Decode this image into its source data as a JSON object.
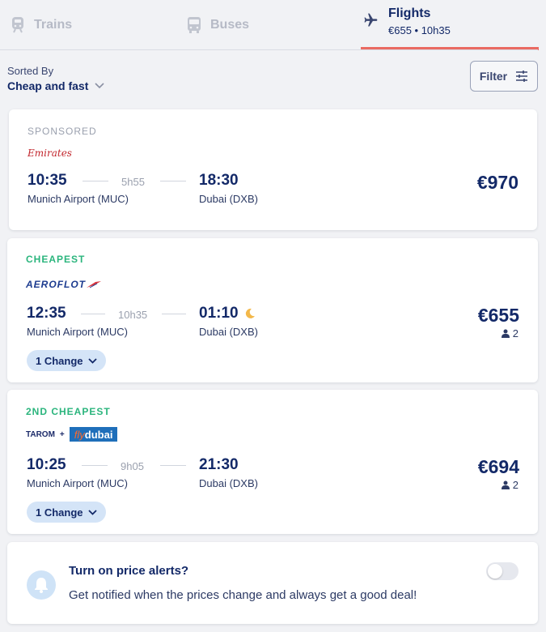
{
  "tabs": {
    "trains": {
      "label": "Trains",
      "icon": "train-icon"
    },
    "buses": {
      "label": "Buses",
      "icon": "bus-icon"
    },
    "flights": {
      "label": "Flights",
      "sub": "€655 • 10h35",
      "icon": "plane-icon",
      "active": true
    }
  },
  "sort": {
    "caption": "Sorted By",
    "value": "Cheap and fast"
  },
  "filter": {
    "label": "Filter"
  },
  "results": [
    {
      "tag": "SPONSORED",
      "airline": "Emirates",
      "depart_time": "10:35",
      "depart_place": "Munich Airport (MUC)",
      "duration": "5h55",
      "arrive_time": "18:30",
      "arrive_place": "Dubai (DXB)",
      "price": "€970"
    },
    {
      "tag": "CHEAPEST",
      "airline": "AEROFLOT",
      "depart_time": "12:35",
      "depart_place": "Munich Airport (MUC)",
      "duration": "10h35",
      "arrive_time": "01:10",
      "arrive_place": "Dubai (DXB)",
      "price": "€655",
      "passengers": "2",
      "changes": "1 Change"
    },
    {
      "tag": "2ND CHEAPEST",
      "airline_1": "TAROM",
      "airline_sep": "+",
      "airline_2_a": "fly",
      "airline_2_b": "dubai",
      "depart_time": "10:25",
      "depart_place": "Munich Airport (MUC)",
      "duration": "9h05",
      "arrive_time": "21:30",
      "arrive_place": "Dubai (DXB)",
      "price": "€694",
      "passengers": "2",
      "changes": "1 Change"
    }
  ],
  "alert": {
    "title": "Turn on price alerts?",
    "text": "Get notified when the prices change and always get a good deal!"
  },
  "colors": {
    "accent": "#ea6a62",
    "navy": "#132968",
    "green": "#2bb57d",
    "chip": "#d4e4f7"
  }
}
